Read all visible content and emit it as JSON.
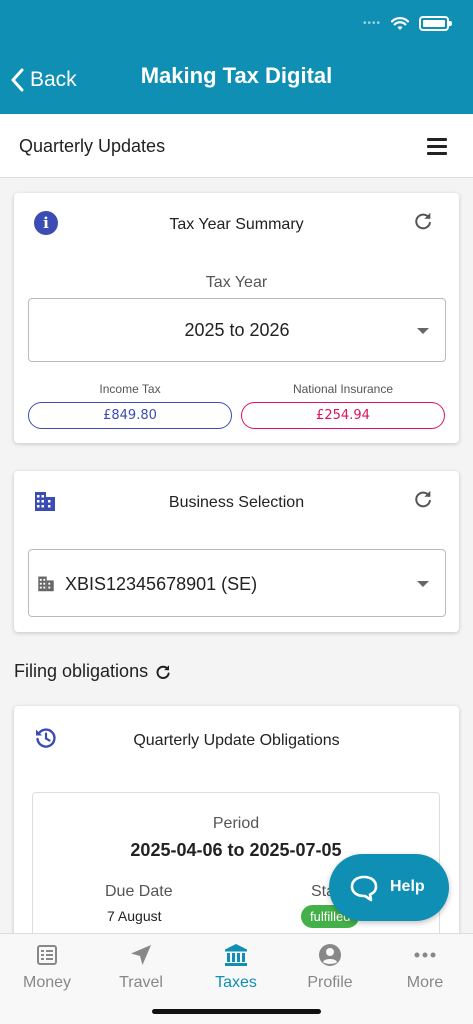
{
  "header": {
    "back_label": "Back",
    "title": "Making Tax Digital"
  },
  "subheader": {
    "title": "Quarterly Updates"
  },
  "summary": {
    "title": "Tax Year Summary",
    "tax_year_label": "Tax Year",
    "tax_year_value": "2025 to 2026",
    "income_tax_label": "Income Tax",
    "income_tax_value": "£849.80",
    "ni_label": "National Insurance",
    "ni_value": "£254.94"
  },
  "business": {
    "title": "Business Selection",
    "selected": "XBIS12345678901 (SE)"
  },
  "filing": {
    "title": "Filing obligations"
  },
  "obligations": {
    "title": "Quarterly Update Obligations",
    "period_label": "Period",
    "period_value": "2025-04-06 to 2025-07-05",
    "due_label": "Due Date",
    "due_value": "7 August",
    "status_label": "Sta",
    "status_value": "fulfilled"
  },
  "help": {
    "label": "Help"
  },
  "tabs": [
    {
      "label": "Money",
      "icon": "ledger-icon"
    },
    {
      "label": "Travel",
      "icon": "navigation-arrow-icon"
    },
    {
      "label": "Taxes",
      "icon": "bank-icon"
    },
    {
      "label": "Profile",
      "icon": "person-icon"
    },
    {
      "label": "More",
      "icon": "more-dots-icon"
    }
  ],
  "colors": {
    "brand": "#0f8fb3",
    "income_tax": "#3b4db3",
    "national_insurance": "#e0105e",
    "fulfilled": "#43b049"
  }
}
